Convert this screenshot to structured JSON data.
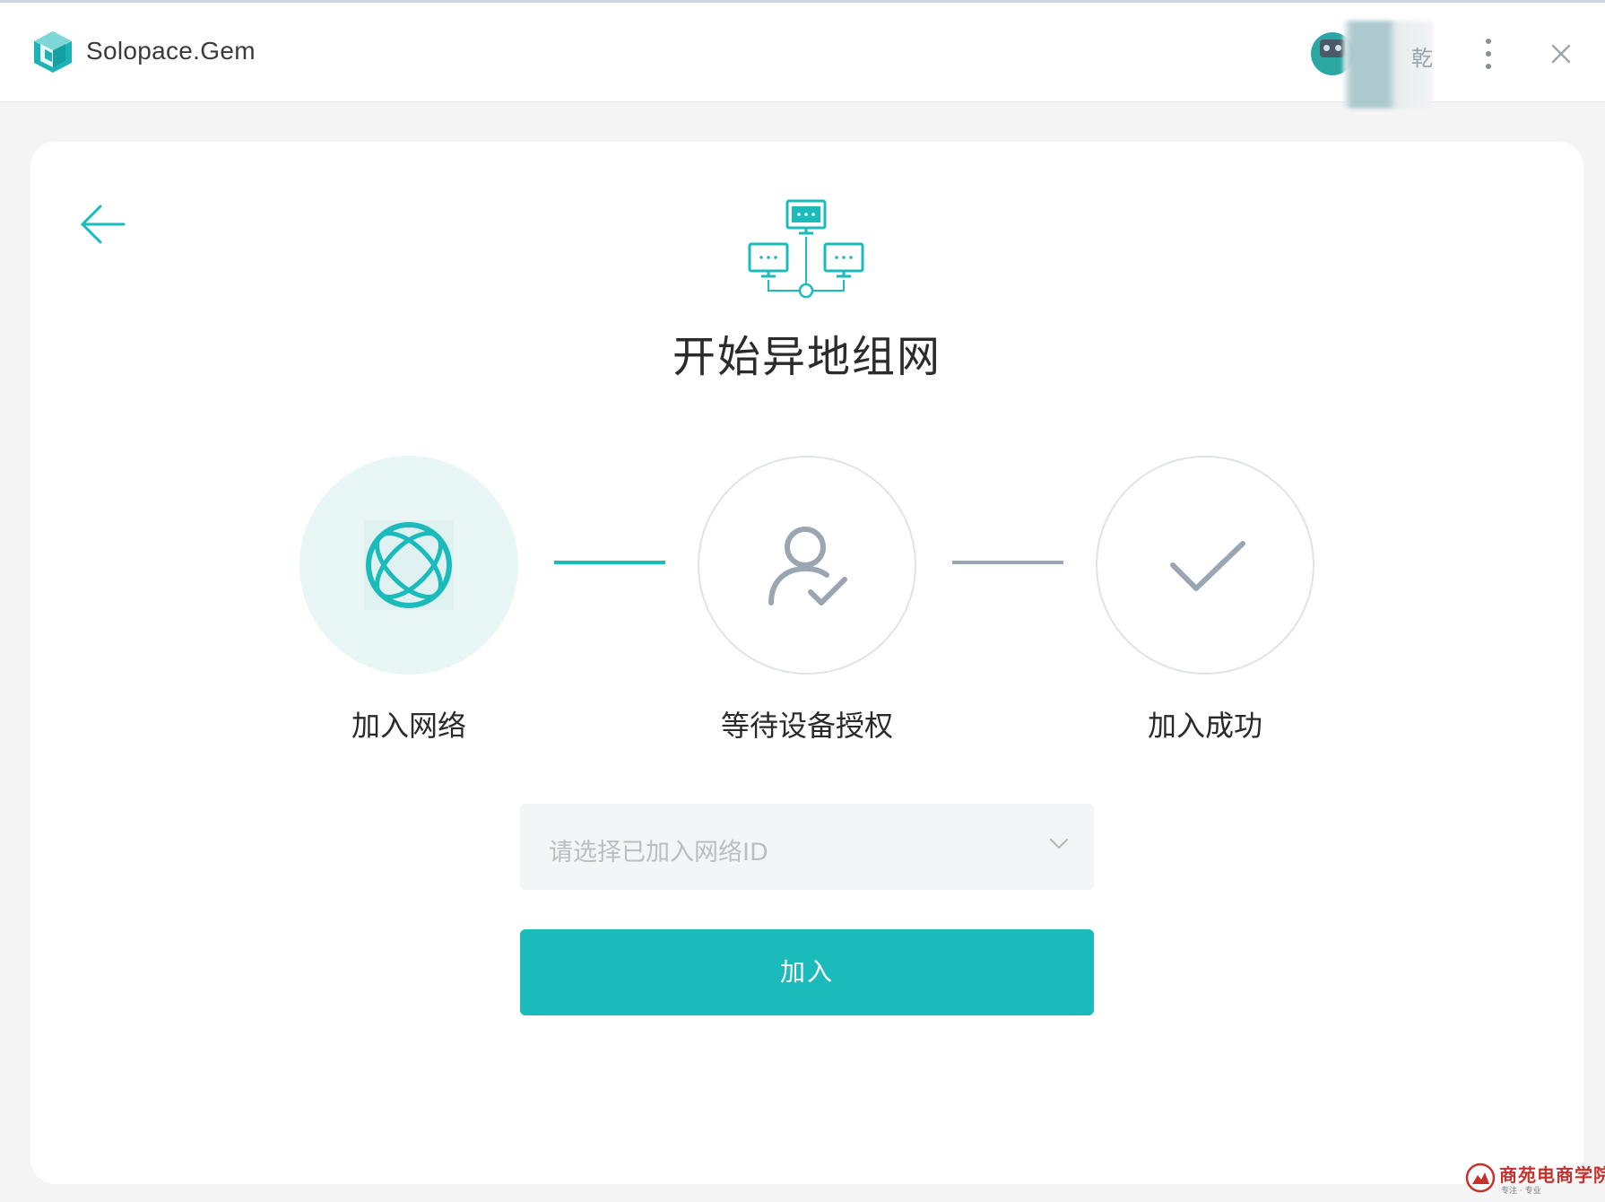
{
  "app": {
    "name": "Solopace.Gem",
    "user_name": "乾"
  },
  "page": {
    "title": "开始异地组网"
  },
  "steps": [
    {
      "label": "加入网络",
      "icon": "network-globe-icon",
      "state": "active"
    },
    {
      "label": "等待设备授权",
      "icon": "user-check-icon",
      "state": "pending"
    },
    {
      "label": "加入成功",
      "icon": "checkmark-icon",
      "state": "pending"
    }
  ],
  "form": {
    "network_select": {
      "placeholder": "请选择已加入网络ID",
      "value": ""
    },
    "join_label": "加入"
  },
  "watermark": {
    "text": "商苑电商学院",
    "sub": "专注 · 专业"
  },
  "colors": {
    "accent": "#1bbbbb",
    "accent_light": "#e8f6f6",
    "inactive_icon": "#9aa6b2",
    "inactive_border": "#dfe3e6",
    "background": "#f5f5f5"
  }
}
